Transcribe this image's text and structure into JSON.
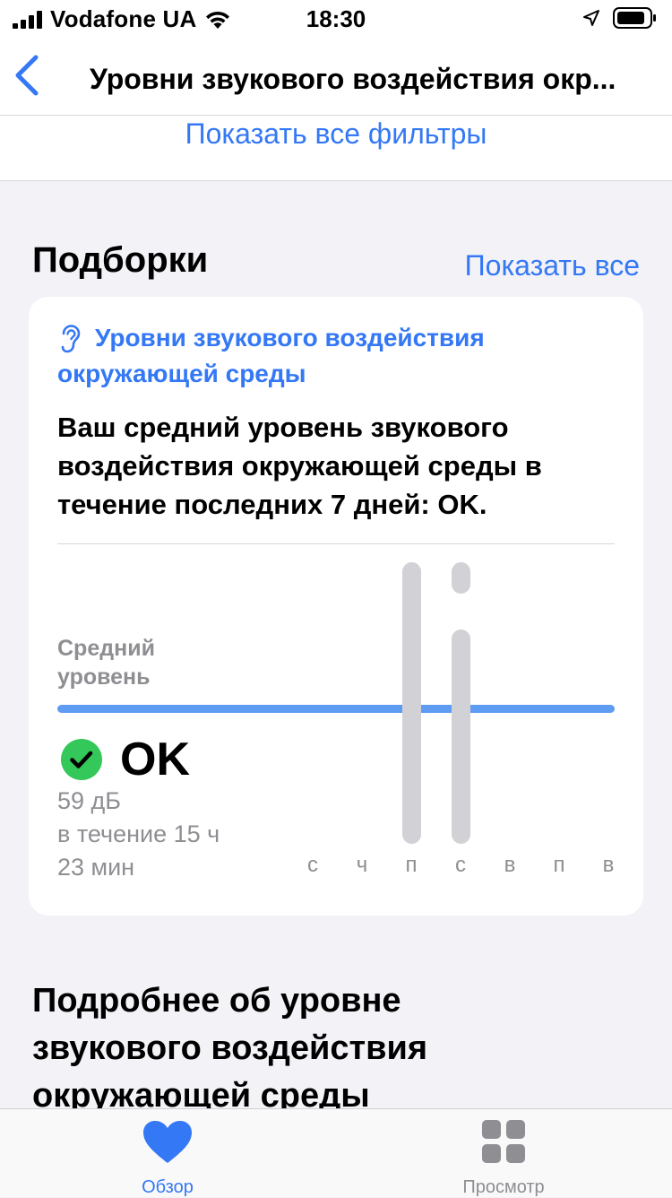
{
  "status_bar": {
    "carrier": "Vodafone UA",
    "time": "18:30"
  },
  "nav": {
    "title": "Уровни звукового воздействия окр..."
  },
  "filters": {
    "show_all_filters": "Показать все фильтры"
  },
  "highlights": {
    "title": "Подборки",
    "show_all": "Показать все",
    "card": {
      "category": "Уровни звукового воздействия окружающей среды",
      "message": "Ваш средний уровень звукового воздействия окружающей среды в течение последних 7 дней: OK.",
      "average_label": "Средний уровень",
      "status": "OK",
      "detail_line1": "59 дБ",
      "detail_line2": "в течение 15 ч",
      "detail_line3": "23 мин"
    }
  },
  "chart_data": {
    "type": "bar",
    "categories": [
      "с",
      "ч",
      "п",
      "с",
      "в",
      "п",
      "в"
    ],
    "average_line": 59,
    "bars": [
      {
        "day_index": 2,
        "ranges": [
          [
            0.0,
            1.0
          ]
        ]
      },
      {
        "day_index": 3,
        "ranges": [
          [
            0.0,
            0.76
          ],
          [
            0.89,
            1.0
          ]
        ]
      }
    ]
  },
  "more": {
    "title": "Подробнее об уровне звукового воздействия окружающей среды"
  },
  "tabs": [
    {
      "label": "Обзор",
      "icon": "heart-icon",
      "active": true
    },
    {
      "label": "Просмотр",
      "icon": "grid-icon",
      "active": false
    }
  ],
  "colors": {
    "accent": "#3478f6",
    "ok_green": "#34c759",
    "bar_gray": "#d1d1d6",
    "avg_line": "#5e9cf4"
  }
}
